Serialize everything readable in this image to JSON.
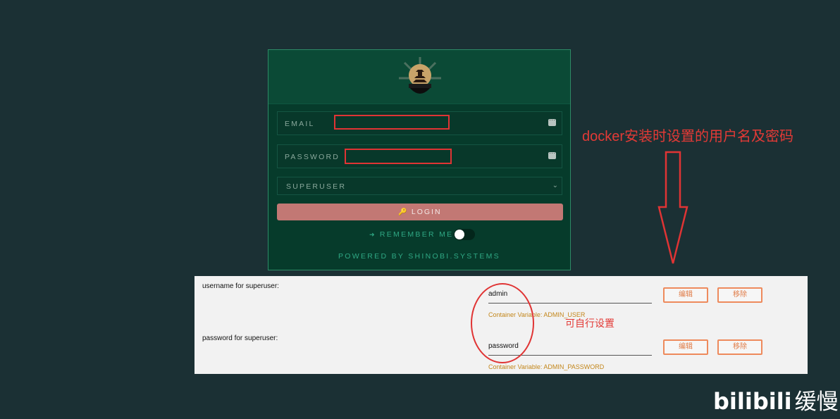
{
  "login": {
    "email_label": "EMAIL",
    "password_label": "PASSWORD",
    "role_select": "SUPERUSER",
    "login_button": "LOGIN",
    "remember_me": "REMEMBER ME",
    "powered_by": "POWERED BY SHINOBI.SYSTEMS"
  },
  "annotation": {
    "docker_note": "docker安装时设置的用户名及密码",
    "self_set_note": "可自行设置"
  },
  "settings": {
    "rows": [
      {
        "label": "username for superuser:",
        "value": "admin",
        "hint": "Container Variable: ADMIN_USER",
        "edit": "编辑",
        "remove": "移除"
      },
      {
        "label": "password for superuser:",
        "value": "password",
        "hint": "Container Variable: ADMIN_PASSWORD",
        "edit": "编辑",
        "remove": "移除"
      }
    ]
  },
  "watermark": {
    "brand": "bilibili",
    "user": "缓慢"
  },
  "colors": {
    "background": "#1b3034",
    "card": "#063b2b",
    "accent": "#2fa884",
    "login_button": "#c27874",
    "annotation_red": "#e33a36",
    "hint_orange": "#c3861a"
  },
  "icons": [
    "shinobi-logo-icon",
    "password-manager-icon",
    "chevron-down-icon",
    "key-icon",
    "sign-in-icon",
    "down-arrow-icon"
  ]
}
